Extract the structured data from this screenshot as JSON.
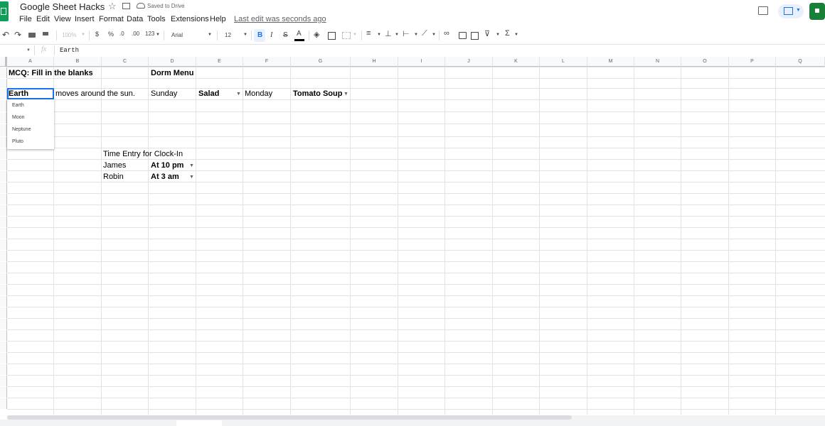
{
  "app": {
    "title": "Google Sheet Hacks",
    "saved_status": "Saved to Drive",
    "last_edit": "Last edit was seconds ago",
    "menu": [
      "File",
      "Edit",
      "View",
      "Insert",
      "Format",
      "Data",
      "Tools",
      "Extensions",
      "Help"
    ]
  },
  "toolbar": {
    "zoom": "100%",
    "currency": "$",
    "percent": "%",
    "dec_decrease": ".0",
    "dec_increase": ".00",
    "more_formats": "123",
    "font": "Arial",
    "font_size": "12",
    "bold": "B",
    "italic": "I",
    "strike": "S",
    "text_color": "A",
    "sigma": "Σ"
  },
  "formula_bar": {
    "fx": "fx",
    "value": "Earth"
  },
  "columns": [
    "A",
    "B",
    "C",
    "D",
    "E",
    "F",
    "G",
    "H",
    "I",
    "J",
    "K",
    "L",
    "M",
    "N",
    "O",
    "P",
    "Q"
  ],
  "cells": {
    "a1": "MCQ: Fill in the blanks",
    "d1": "Dorm Menu",
    "a3": "Earth",
    "b3": "moves around the sun.",
    "d3": "Sunday",
    "e3": "Salad",
    "f3": "Monday",
    "g3": "Tomato Soup",
    "c9": "Time Entry for Clock-In",
    "c10": "James",
    "d10": "At 10 pm",
    "c11": "Robin",
    "d11": "At 3 am"
  },
  "dropdown": {
    "options": [
      "Earth",
      "Moon",
      "Neptune",
      "Pluto"
    ]
  },
  "colors": {
    "selection": "#1a73e8",
    "sheets_green": "#0f9d58",
    "gridline": "#e2e3e3"
  }
}
